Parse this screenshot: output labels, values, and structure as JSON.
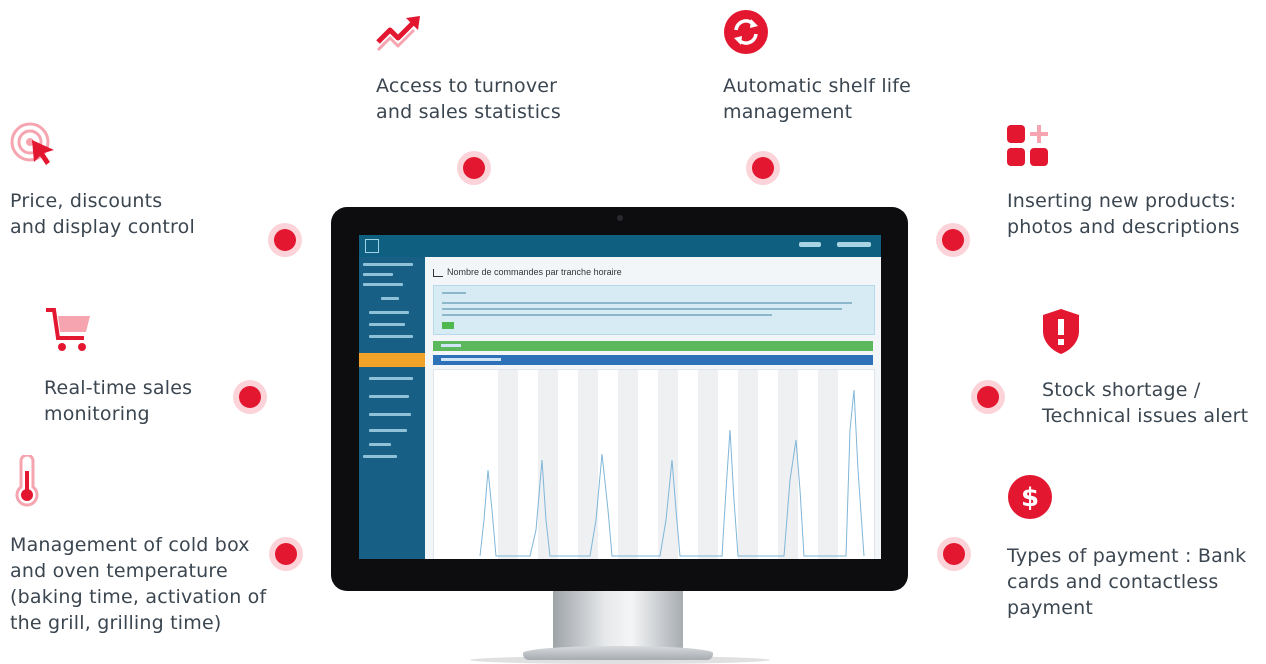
{
  "features": {
    "turnover": {
      "lines": [
        "Access to turnover",
        "and sales statistics"
      ],
      "icon": "trending-up-icon"
    },
    "shelf_life": {
      "lines": [
        "Automatic shelf life",
        "management"
      ],
      "icon": "refresh-icon"
    },
    "price": {
      "lines": [
        "Price, discounts",
        "and display control"
      ],
      "icon": "click-target-icon"
    },
    "products": {
      "lines": [
        "Inserting new products:",
        "photos and descriptions"
      ],
      "icon": "add-grid-icon"
    },
    "sales": {
      "lines": [
        "Real-time sales",
        "monitoring"
      ],
      "icon": "cart-icon"
    },
    "stock": {
      "lines": [
        "Stock shortage /",
        "Technical issues alert"
      ],
      "icon": "shield-alert-icon"
    },
    "temperature": {
      "lines": [
        "Management of cold box",
        "and oven temperature",
        "(baking time, activation of",
        "the grill, grilling time)"
      ],
      "icon": "thermometer-icon"
    },
    "payment": {
      "lines": [
        "Types of payment : Bank",
        "cards and contactless",
        "payment"
      ],
      "icon": "dollar-icon"
    }
  },
  "screen": {
    "page_title": "Nombre de commandes par tranche horaire"
  },
  "colors": {
    "accent": "#e3172f",
    "accent_light": "#fbd3d8",
    "text": "#3b4650",
    "screen_topbar": "#0f5f80",
    "screen_sidebar": "#175f85",
    "screen_active": "#f0a328",
    "screen_green": "#5cb85c",
    "screen_blue": "#2d72b9"
  }
}
